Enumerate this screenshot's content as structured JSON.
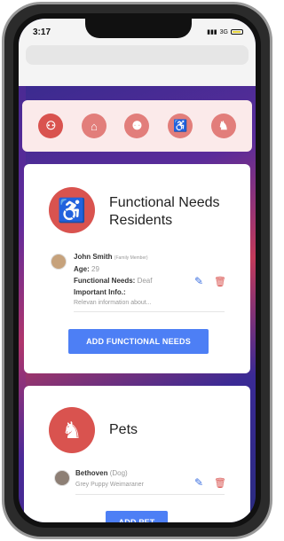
{
  "status": {
    "time": "3:17",
    "network": "3G"
  },
  "iconbar": [
    {
      "name": "person-icon",
      "glyph": "👤"
    },
    {
      "name": "house-icon",
      "glyph": "⌂"
    },
    {
      "name": "people-icon",
      "glyph": "👥"
    },
    {
      "name": "wheelchair-icon",
      "glyph": "♿"
    },
    {
      "name": "dog-icon",
      "glyph": "🐕"
    }
  ],
  "functional": {
    "title_line1": "Functional Needs",
    "title_line2": "Residents",
    "resident": {
      "name": "John Smith",
      "relation": "(Family Member)",
      "age_label": "Age:",
      "age_value": "29",
      "needs_label": "Functional Needs:",
      "needs_value": "Deaf",
      "info_label": "Important Info.:",
      "info_value": "Relevan information about..."
    },
    "button": "ADD FUNCTIONAL NEEDS"
  },
  "pets": {
    "title": "Pets",
    "pet": {
      "name": "Bethoven",
      "type": "(Dog)",
      "description": "Grey Puppy Weimaraner"
    },
    "button": "ADD PET"
  },
  "colors": {
    "accent": "#d9534f",
    "button": "#4d7ff5"
  }
}
